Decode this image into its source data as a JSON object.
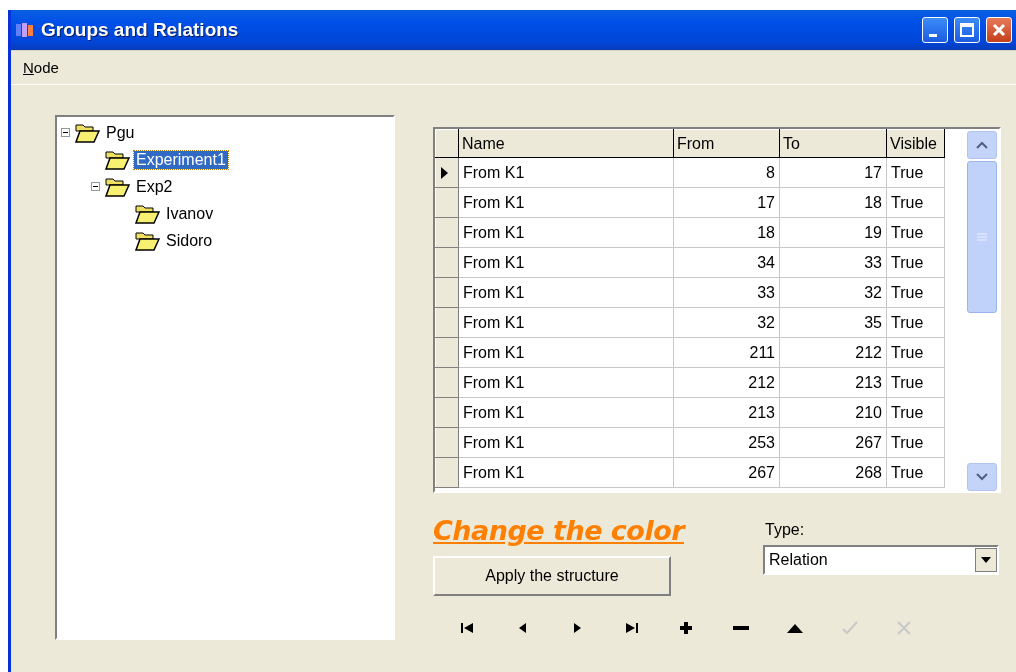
{
  "window": {
    "title": "Groups and Relations"
  },
  "menu": [
    {
      "label": "Node"
    }
  ],
  "tree": [
    {
      "label": "Pgu",
      "expanded": true,
      "selected": false,
      "children": [
        {
          "label": "Experiment1",
          "selected": true
        },
        {
          "label": "Exp2",
          "expanded": true,
          "selected": false,
          "children": [
            {
              "label": "Ivanov",
              "selected": false
            },
            {
              "label": "Sidoro",
              "selected": false
            }
          ]
        }
      ]
    }
  ],
  "table": {
    "columns": [
      "Name",
      "From",
      "To",
      "Visible"
    ],
    "rows": [
      {
        "cells": [
          "From K1",
          "8",
          "17",
          "True"
        ],
        "selected": true
      },
      {
        "cells": [
          "From K1",
          "17",
          "18",
          "True"
        ],
        "selected": false
      },
      {
        "cells": [
          "From K1",
          "18",
          "19",
          "True"
        ],
        "selected": false
      },
      {
        "cells": [
          "From K1",
          "34",
          "33",
          "True"
        ],
        "selected": false
      },
      {
        "cells": [
          "From K1",
          "33",
          "32",
          "True"
        ],
        "selected": false
      },
      {
        "cells": [
          "From K1",
          "32",
          "35",
          "True"
        ],
        "selected": false
      },
      {
        "cells": [
          "From K1",
          "211",
          "212",
          "True"
        ],
        "selected": false
      },
      {
        "cells": [
          "From K1",
          "212",
          "213",
          "True"
        ],
        "selected": false
      },
      {
        "cells": [
          "From K1",
          "213",
          "210",
          "True"
        ],
        "selected": false
      },
      {
        "cells": [
          "From K1",
          "253",
          "267",
          "True"
        ],
        "selected": false
      },
      {
        "cells": [
          "From K1",
          "267",
          "268",
          "True"
        ],
        "selected": false
      }
    ]
  },
  "color_link": "Change the color",
  "apply_button": "Apply the structure",
  "type_field": {
    "label": "Type:",
    "value": "Relation"
  },
  "navigator": [
    {
      "kind": "first",
      "disabled": false
    },
    {
      "kind": "prior",
      "disabled": false
    },
    {
      "kind": "next",
      "disabled": false
    },
    {
      "kind": "last",
      "disabled": false
    },
    {
      "kind": "insert",
      "disabled": false
    },
    {
      "kind": "delete",
      "disabled": false
    },
    {
      "kind": "edit",
      "disabled": false
    },
    {
      "kind": "post",
      "disabled": true
    },
    {
      "kind": "cancel",
      "disabled": true
    }
  ]
}
